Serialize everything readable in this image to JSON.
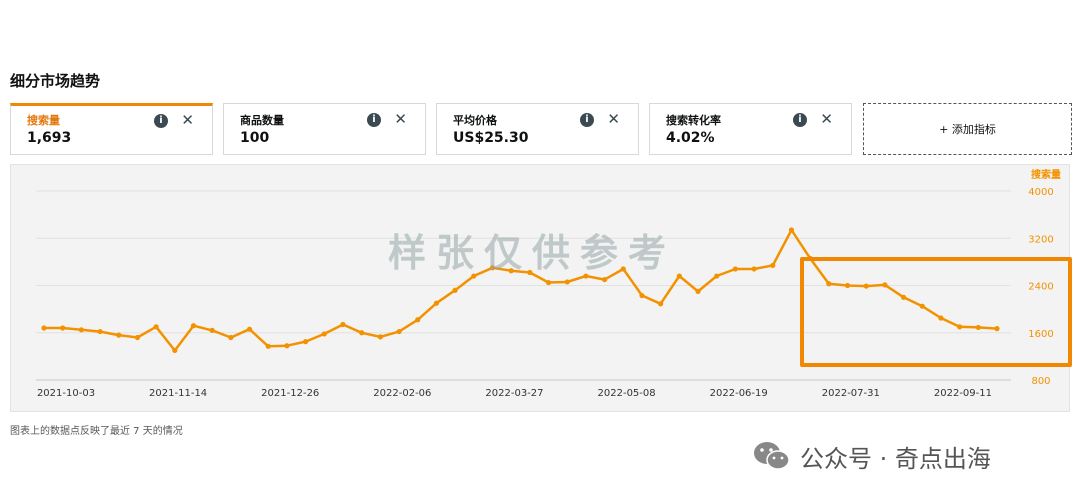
{
  "section_title": "细分市场趋势",
  "metrics": [
    {
      "label": "搜索量",
      "value": "1,693",
      "active": true
    },
    {
      "label": "商品数量",
      "value": "100",
      "active": false
    },
    {
      "label": "平均价格",
      "value": "US$25.30",
      "active": false
    },
    {
      "label": "搜索转化率",
      "value": "4.02%",
      "active": false
    }
  ],
  "info_glyph": "i",
  "close_glyph": "✕",
  "add_metric_label": "+ 添加指标",
  "footnote": "图表上的数据点反映了最近 7 天的情况",
  "watermark": "样张仅供参考",
  "brand": {
    "text": "公众号 · 奇点出海",
    "icon": "wechat-icon"
  },
  "colors": {
    "accent": "#f08804",
    "line": "#f39200"
  },
  "chart_data": {
    "type": "line",
    "series_label": "搜索量",
    "x_ticks": [
      "2021-10-03",
      "2021-11-14",
      "2021-12-26",
      "2022-02-06",
      "2022-03-27",
      "2022-05-08",
      "2022-06-19",
      "2022-07-31",
      "2022-09-11"
    ],
    "y_ticks": [
      800,
      1600,
      2400,
      3200,
      4000
    ],
    "y_tick_labels": [
      "800",
      "1600",
      "2400",
      "3200",
      "4000"
    ],
    "ylim": [
      800,
      4000
    ],
    "axis_position": "right",
    "grid": true,
    "values": [
      1680,
      1680,
      1650,
      1620,
      1560,
      1520,
      1700,
      1300,
      1720,
      1640,
      1520,
      1660,
      1370,
      1380,
      1450,
      1580,
      1740,
      1600,
      1530,
      1620,
      1820,
      2100,
      2320,
      2560,
      2700,
      2650,
      2620,
      2450,
      2460,
      2560,
      2500,
      2680,
      2230,
      2090,
      2560,
      2300,
      2560,
      2680,
      2680,
      2740,
      3340,
      2860,
      2430,
      2400,
      2390,
      2410,
      2200,
      2050,
      1850,
      1700,
      1690,
      1670
    ]
  }
}
